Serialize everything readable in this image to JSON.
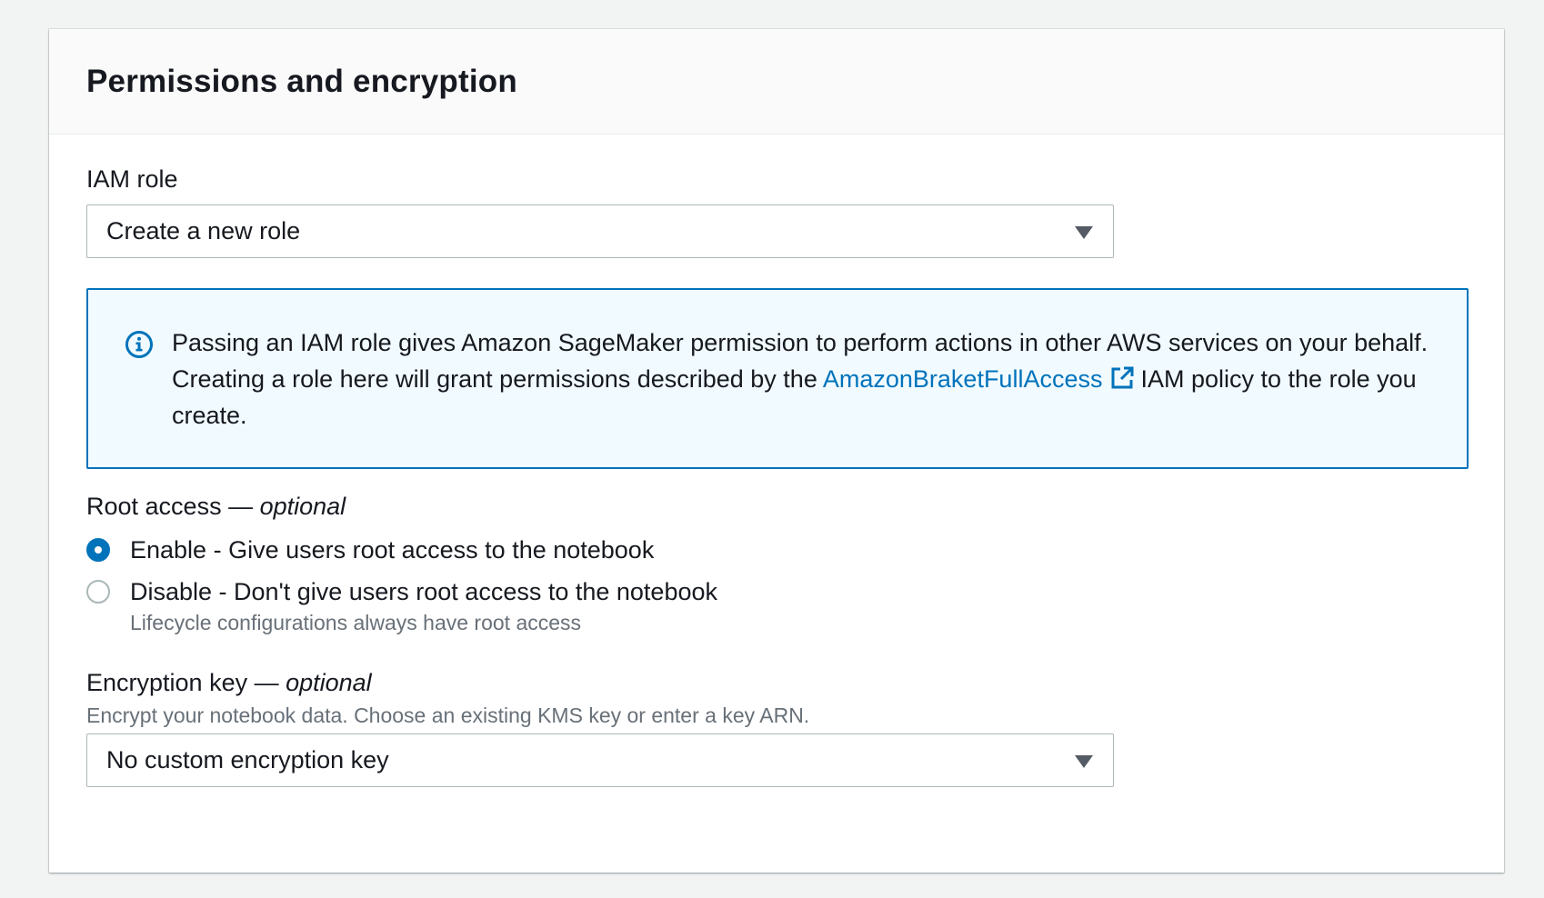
{
  "panel": {
    "title": "Permissions and encryption"
  },
  "iam_role": {
    "label": "IAM role",
    "selected": "Create a new role"
  },
  "info": {
    "text_before_link": "Passing an IAM role gives Amazon SageMaker permission to perform actions in other AWS services on your behalf. Creating a role here will grant permissions described by the ",
    "link_label": "AmazonBraketFullAccess",
    "text_after_link": "IAM policy to the role you create.",
    "icon": "info-circle-icon",
    "link_icon": "external-link-icon"
  },
  "root_access": {
    "label": "Root access — ",
    "label_optional": "optional",
    "options": [
      {
        "label": "Enable - Give users root access to the notebook",
        "checked": true
      },
      {
        "label": "Disable - Don't give users root access to the notebook",
        "checked": false,
        "description": "Lifecycle configurations always have root access"
      }
    ]
  },
  "encryption": {
    "label": "Encryption key — ",
    "label_optional": "optional",
    "description": "Encrypt your notebook data. Choose an existing KMS key or enter a key ARN.",
    "selected": "No custom encryption key"
  },
  "colors": {
    "accent": "#0073bb",
    "info_background": "#f1faff",
    "muted_text": "#687078"
  }
}
